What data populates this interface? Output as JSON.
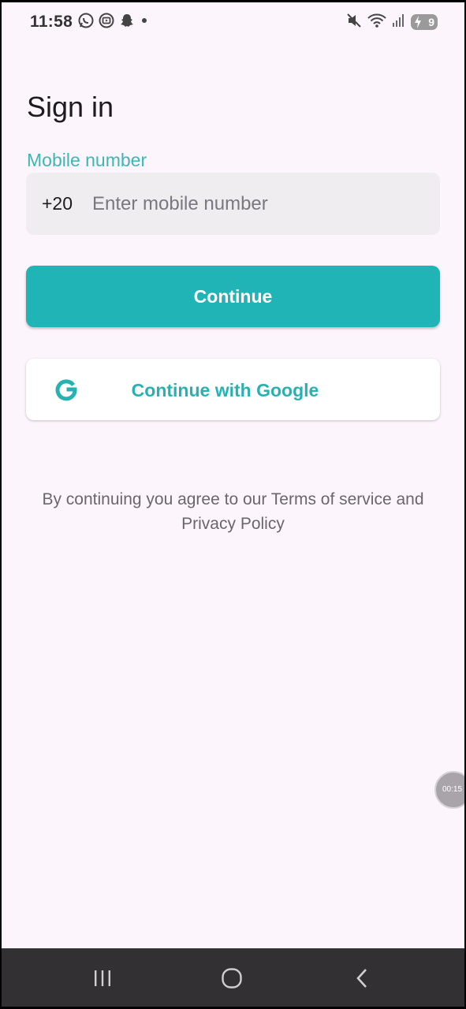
{
  "status_bar": {
    "time": "11:58",
    "battery_level": "9",
    "left_icons": [
      "whatsapp-icon",
      "media-icon",
      "snapchat-icon",
      "dot-icon"
    ],
    "right_icons": [
      "mute-icon",
      "wifi-icon",
      "signal-icon",
      "battery-icon"
    ]
  },
  "page": {
    "title": "Sign in"
  },
  "mobile_field": {
    "label": "Mobile number",
    "prefix": "+20",
    "value": "",
    "placeholder": "Enter mobile number"
  },
  "buttons": {
    "continue_label": "Continue",
    "google_label": "Continue with Google"
  },
  "terms": {
    "text": "By continuing you agree to our Terms of service and Privacy Policy"
  },
  "recording": {
    "timer": "00:15"
  },
  "nav": {
    "items": [
      "recents-icon",
      "home-icon",
      "back-icon"
    ]
  },
  "colors": {
    "accent": "#20b4b6",
    "background": "#fdf5fc",
    "field_bg": "#efedf0"
  }
}
